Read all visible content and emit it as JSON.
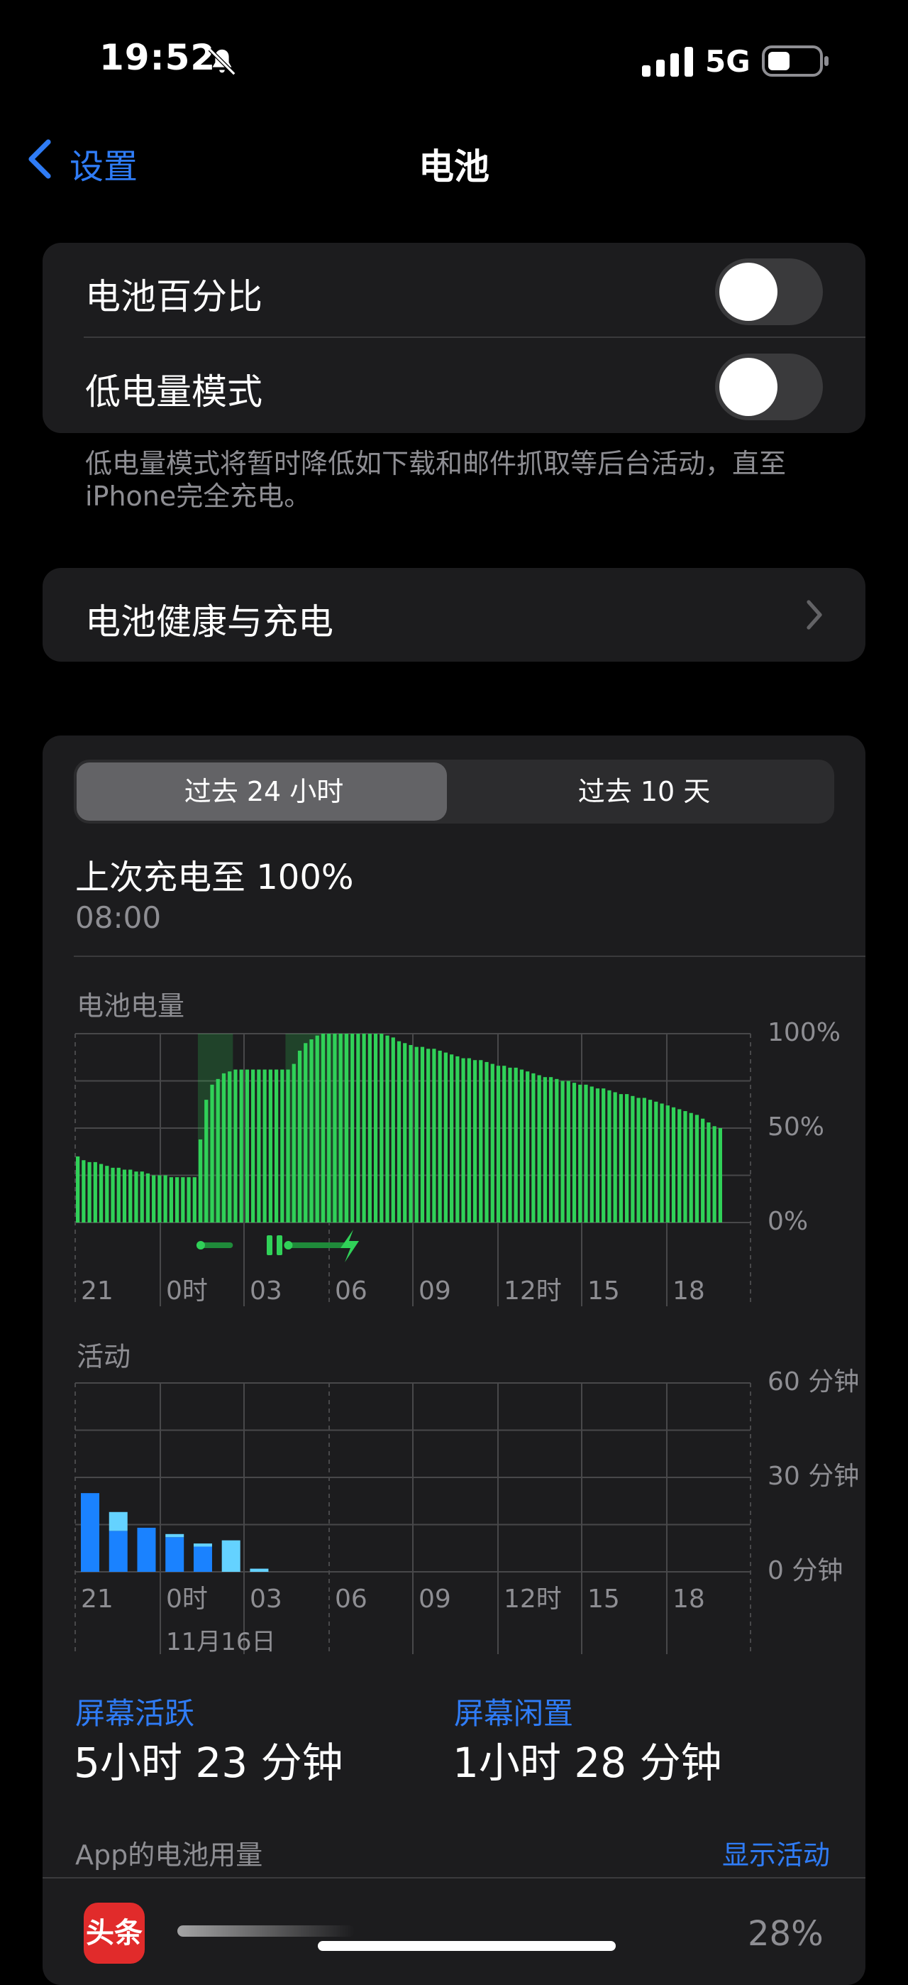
{
  "status_bar": {
    "time": "19:52",
    "network": "5G",
    "icons": [
      "bell-slash-icon",
      "cellular-signal-icon",
      "battery-icon"
    ]
  },
  "nav": {
    "back_label": "设置",
    "title": "电池"
  },
  "settings": {
    "battery_percentage": {
      "label": "电池百分比",
      "on": false
    },
    "low_power_mode": {
      "label": "低电量模式",
      "on": false
    },
    "low_power_note": "低电量模式将暂时降低如下载和邮件抓取等后台活动，直至iPhone完全充电。",
    "battery_health": {
      "label": "电池健康与充电"
    }
  },
  "usage": {
    "tabs": [
      {
        "label": "过去 24 小时",
        "active": true
      },
      {
        "label": "过去 10 天",
        "active": false
      }
    ],
    "last_charged_title": "上次充电至 100%",
    "last_charged_time": "08:00",
    "screen_active_label": "屏幕活跃",
    "screen_active_value": "5小时 23 分钟",
    "screen_idle_label": "屏幕闲置",
    "screen_idle_value": "1小时 28 分钟",
    "app_usage_label": "App的电池用量",
    "show_activity_label": "显示活动",
    "apps": [
      {
        "icon_text": "头条",
        "percent": "28%"
      }
    ]
  },
  "colors": {
    "accent_blue": "#2f7cf6",
    "battery_green": "#30d158",
    "activity_dark_blue": "#1a82ff",
    "activity_light_blue": "#64d2ff"
  },
  "chart_data": [
    {
      "type": "bar",
      "title": "电池电量",
      "x_tick_labels": [
        "21",
        "0时",
        "03",
        "06",
        "09",
        "12时",
        "15",
        "18"
      ],
      "y_tick_labels": [
        "100%",
        "50%",
        "0%"
      ],
      "ylim": [
        0,
        100
      ],
      "values": [
        35,
        33,
        32,
        32,
        31,
        30,
        29,
        29,
        28,
        28,
        27,
        27,
        26,
        25,
        25,
        25,
        24,
        24,
        24,
        24,
        24,
        44,
        65,
        73,
        76,
        79,
        80,
        81,
        81,
        81,
        81,
        81,
        81,
        81,
        81,
        81,
        81,
        84,
        91,
        95,
        97,
        99,
        100,
        100,
        100,
        100,
        100,
        100,
        100,
        100,
        100,
        100,
        100,
        99,
        98,
        96,
        95,
        94,
        93,
        93,
        92,
        92,
        91,
        90,
        89,
        88,
        87,
        87,
        86,
        86,
        85,
        84,
        83,
        83,
        82,
        82,
        81,
        80,
        79,
        78,
        77,
        77,
        76,
        75,
        75,
        74,
        73,
        73,
        72,
        71,
        71,
        70,
        69,
        68,
        68,
        67,
        66,
        66,
        65,
        64,
        63,
        62,
        61,
        60,
        59,
        58,
        57,
        55,
        53,
        51,
        50
      ],
      "charging_intervals": [
        [
          21,
          27
        ],
        [
          36,
          47
        ]
      ]
    },
    {
      "type": "bar",
      "title": "活动",
      "x_tick_labels": [
        "21",
        "0时",
        "03",
        "06",
        "09",
        "12时",
        "15",
        "18"
      ],
      "date_label": "11月16日",
      "y_tick_labels": [
        "60 分钟",
        "30 分钟",
        "0 分钟"
      ],
      "ylim": [
        0,
        60
      ],
      "series": [
        {
          "name": "屏幕活跃",
          "values": [
            25,
            13,
            14,
            11,
            8,
            0,
            0,
            0,
            0,
            0,
            0,
            0,
            0,
            0,
            0,
            0,
            0,
            0,
            0,
            0,
            0,
            0,
            0,
            0,
            0
          ]
        },
        {
          "name": "屏幕闲置",
          "values": [
            0,
            6,
            0,
            1,
            1,
            10,
            1,
            0,
            0,
            0,
            0,
            0,
            0,
            0,
            0,
            0,
            0,
            0,
            0,
            0,
            0,
            0,
            0,
            0,
            0
          ]
        }
      ]
    }
  ]
}
